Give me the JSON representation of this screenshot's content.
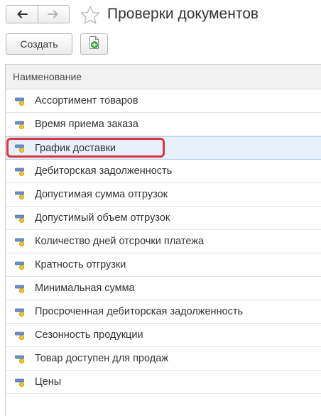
{
  "header": {
    "title": "Проверки документов",
    "back_icon": "arrow-left-icon",
    "forward_icon": "arrow-right-icon",
    "favorite_icon": "star-icon"
  },
  "toolbar": {
    "create_label": "Создать",
    "add_icon": "add-document-icon"
  },
  "list": {
    "column_header": "Наименование",
    "selected_index": 2,
    "items": [
      {
        "label": "Ассортимент товаров"
      },
      {
        "label": "Время приема заказа"
      },
      {
        "label": "График доставки"
      },
      {
        "label": "Дебиторская задолженность"
      },
      {
        "label": "Допустимая сумма отгрузок"
      },
      {
        "label": "Допустимый объем отгрузок"
      },
      {
        "label": "Количество дней отсрочки платежа"
      },
      {
        "label": "Кратность отгрузки"
      },
      {
        "label": "Минимальная сумма"
      },
      {
        "label": "Просроченная дебиторская задолженность"
      },
      {
        "label": "Сезонность продукции"
      },
      {
        "label": "Товар доступен для продаж"
      },
      {
        "label": "Цены"
      }
    ]
  },
  "colors": {
    "highlight_border": "#d9363e",
    "selected_row_bg": "#e7f0fb",
    "item_icon_bar": "#6b8fc7",
    "item_icon_dot": "#f2c230"
  }
}
